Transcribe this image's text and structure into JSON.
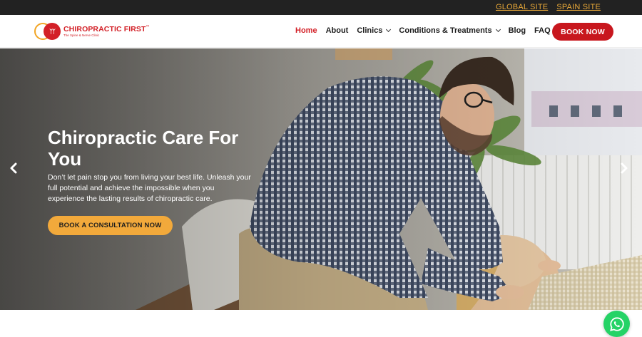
{
  "topbar": {
    "links": [
      "GLOBAL SITE",
      "SPAIN SITE"
    ]
  },
  "brand": {
    "name": "CHIROPRACTIC FIRST",
    "trademark": "™",
    "tagline": "The Spine & Nerve Clinic",
    "primary_color": "#d32027",
    "accent_color": "#f2a524"
  },
  "nav": {
    "items": [
      {
        "label": "Home",
        "active": true,
        "dropdown": false
      },
      {
        "label": "About",
        "active": false,
        "dropdown": false
      },
      {
        "label": "Clinics",
        "active": false,
        "dropdown": true
      },
      {
        "label": "Conditions & Treatments",
        "active": false,
        "dropdown": true
      },
      {
        "label": "Blog",
        "active": false,
        "dropdown": false
      },
      {
        "label": "FAQ",
        "active": false,
        "dropdown": false
      }
    ],
    "book_label": "BOOK NOW"
  },
  "hero": {
    "title": "Chiropractic Care For You",
    "subtitle": "Don’t let pain stop you from living your best life. Unleash your full potential and achieve the impossible when you experience the lasting results of chiropractic care.",
    "cta_label": "BOOK A CONSULTATION NOW",
    "cta_color": "#f2a93b",
    "prev_icon": "chevron-left-icon",
    "next_icon": "chevron-right-icon"
  },
  "floating": {
    "whatsapp_icon": "whatsapp-icon",
    "whatsapp_color": "#25d366"
  }
}
